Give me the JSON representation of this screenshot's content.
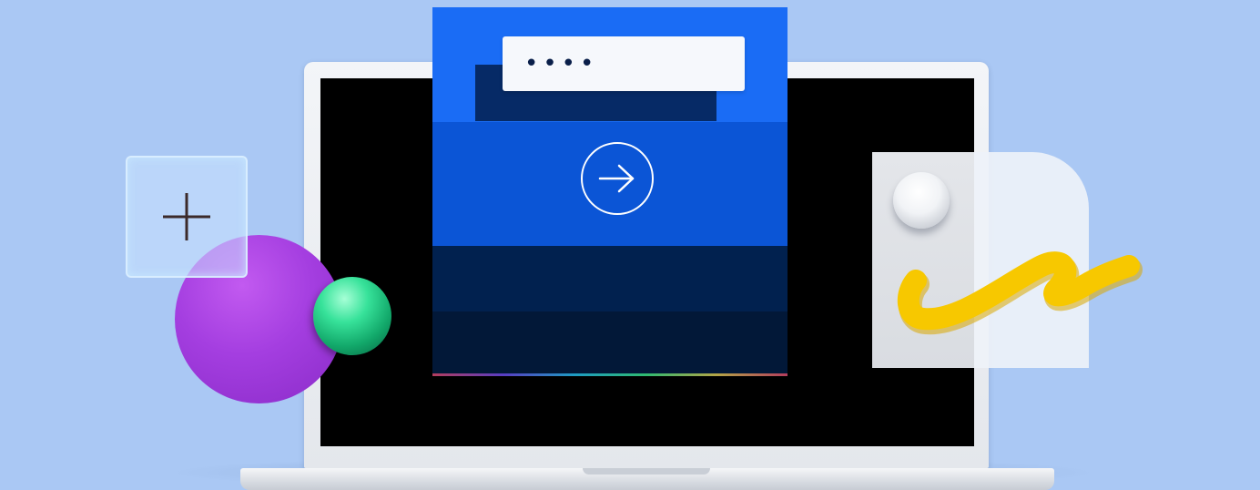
{
  "scene": {
    "background_color": "#aac8f4",
    "password_mask": "••••",
    "icons": {
      "submit": "arrow-right-circle-icon",
      "add": "plus-icon",
      "signature": "signature-squiggle-icon"
    },
    "colors": {
      "panel_blue": "#1a6cf5",
      "panel_mid_blue": "#0b55d6",
      "panel_navy": "#01214f",
      "sphere_purple": "#a43ee0",
      "ball_green": "#37e29a",
      "signature_yellow": "#f7c800"
    }
  }
}
